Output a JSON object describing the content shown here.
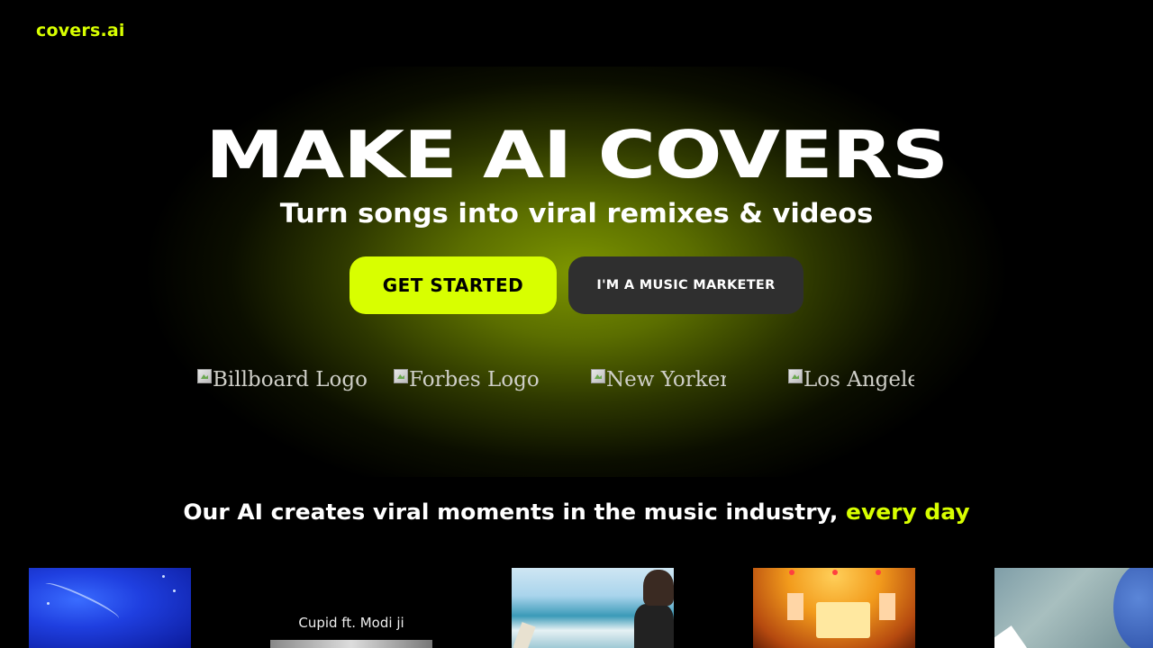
{
  "brand": {
    "name": "covers.ai"
  },
  "hero": {
    "headline": "MAKE AI COVERS",
    "subheadline": "Turn songs into viral remixes & videos",
    "primary_cta": "GET STARTED",
    "secondary_cta": "I'M A MUSIC MARKETER",
    "press_logos": [
      {
        "alt": "Billboard Logo"
      },
      {
        "alt": "Forbes Logo"
      },
      {
        "alt": "New Yorker"
      },
      {
        "alt": "Los Angeles"
      }
    ]
  },
  "tagline": {
    "text": "Our AI creates viral moments in the music industry,",
    "accent": "every day"
  },
  "videos": [
    {
      "caption": ""
    },
    {
      "caption": "Cupid ft. Modi ji"
    },
    {
      "caption": ""
    },
    {
      "caption": ""
    },
    {
      "caption": ""
    }
  ],
  "colors": {
    "accent": "#d8ff00",
    "background": "#000000",
    "secondary_button": "#2f2f2f",
    "hero_glow": "#7d9600"
  }
}
